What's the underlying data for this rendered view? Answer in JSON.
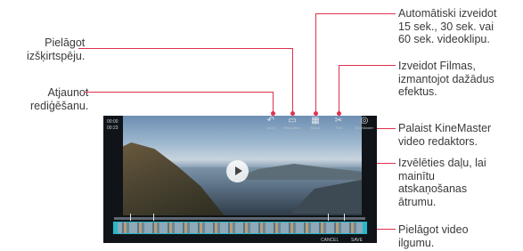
{
  "callouts": {
    "resolution": "Pielāgot izšķirtspēju.",
    "undo": "Atjaunot rediģēšanu.",
    "auto_create": "Automātiski izveidot 15 sek., 30 sek. vai 60 sek. videoklipu.",
    "movie": "Izveidot Filmas, izmantojot dažādus efektus.",
    "kinemaster": "Palaist KineMaster video redaktors.",
    "speed": "Izvēlēties daļu, lai mainītu atskaņošanas ātrumu.",
    "duration": "Pielāgot video ilgumu."
  },
  "callout_lines": {
    "resolution": [
      "Pielāgot",
      "izšķirtspēju."
    ],
    "undo": [
      "Atjaunot",
      "rediģēšanu."
    ],
    "auto_create": [
      "Automātiski izveidot",
      "15 sek., 30 sek. vai",
      "60 sek. videoklipu."
    ],
    "movie": [
      "Izveidot Filmas,",
      "izmantojot dažādus",
      "efektus."
    ],
    "kinemaster": [
      "Palaist KineMaster",
      "video redaktors."
    ],
    "speed": [
      "Izvēlēties daļu, lai",
      "mainītu",
      "atskaņošanas",
      "ātrumu."
    ],
    "duration": [
      "Pielāgot video",
      "ilgumu."
    ]
  },
  "editor": {
    "time_current": "00:00",
    "time_total": "00:23",
    "toolbar": [
      {
        "icon": "undo-icon",
        "glyph": "↶",
        "label": "Undo"
      },
      {
        "icon": "resolution-icon",
        "glyph": "▭",
        "label": "Resolution"
      },
      {
        "icon": "film-icon",
        "glyph": "▦",
        "label": "Movie"
      },
      {
        "icon": "trim-icon",
        "glyph": "✂",
        "label": "Trim"
      },
      {
        "icon": "kinemaster-icon",
        "glyph": "◎",
        "label": "KineMaster"
      }
    ],
    "cancel": "CANCEL",
    "save": "SAVE"
  },
  "colors": {
    "callout_line": "#e0304e",
    "filmstrip_border": "#27b7c9"
  }
}
